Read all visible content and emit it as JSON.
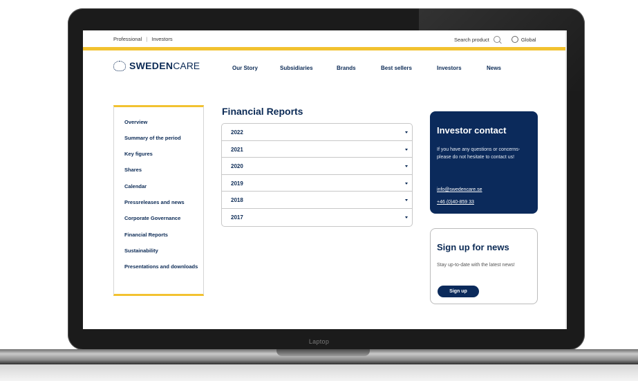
{
  "device": {
    "label": "Laptop"
  },
  "topbar": {
    "left_links": [
      "Professional",
      "Investors"
    ],
    "separator": "|",
    "search_label": "Search product",
    "region_label": "Global"
  },
  "logo": {
    "bold": "SWEDEN",
    "thin": "CARE"
  },
  "nav": [
    "Our Story",
    "Subsidiaries",
    "Brands",
    "Best sellers",
    "Investors",
    "News"
  ],
  "sidebar": [
    "Overview",
    "Summary of the period",
    "Key figures",
    "Shares",
    "Calendar",
    "Pressreleases and news",
    "Corporate Governance",
    "Financial Reports",
    "Sustainability",
    "Presentations and downloads"
  ],
  "page_title": "Financial Reports",
  "years": [
    "2022",
    "2021",
    "2020",
    "2019",
    "2018",
    "2017"
  ],
  "contact": {
    "title": "Investor contact",
    "text": "If you have any questions or concerns- please do not hesitate to contact us!",
    "email": "info@swedencare.se",
    "phone": "+46 (0)40-859 33"
  },
  "newsletter": {
    "title": "Sign up for news",
    "text": "Stay up-to-date with the latest news!",
    "button": "Sign up"
  },
  "colors": {
    "accent": "#f2c230",
    "brand": "#0b2a5b"
  }
}
